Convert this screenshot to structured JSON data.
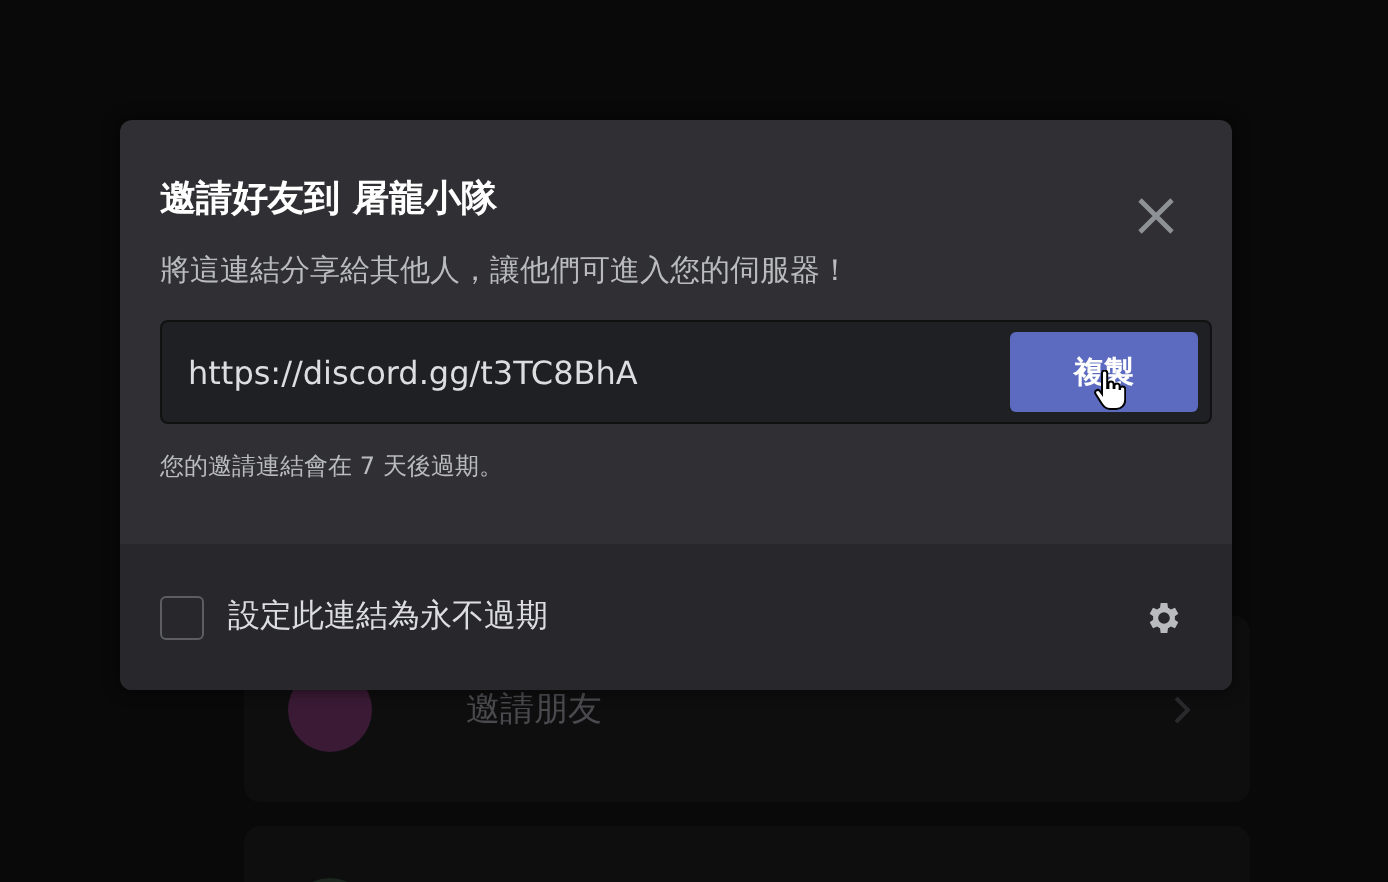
{
  "background_list": [
    {
      "label": "邀請朋友",
      "color": "#3a1a35"
    },
    {
      "color": "#1a261e"
    }
  ],
  "dialog": {
    "title": "邀請好友到 屠龍小隊",
    "description": "將這連結分享給其他人，讓他們可進入您的伺服器！",
    "invite_link": "https://discord.gg/t3TC8BhA",
    "copy_button": "複製",
    "expiry_note": "您的邀請連結會在 7 天後過期。"
  },
  "footer": {
    "never_expire": {
      "label": "設定此連結為永不過期",
      "checked": false
    }
  }
}
